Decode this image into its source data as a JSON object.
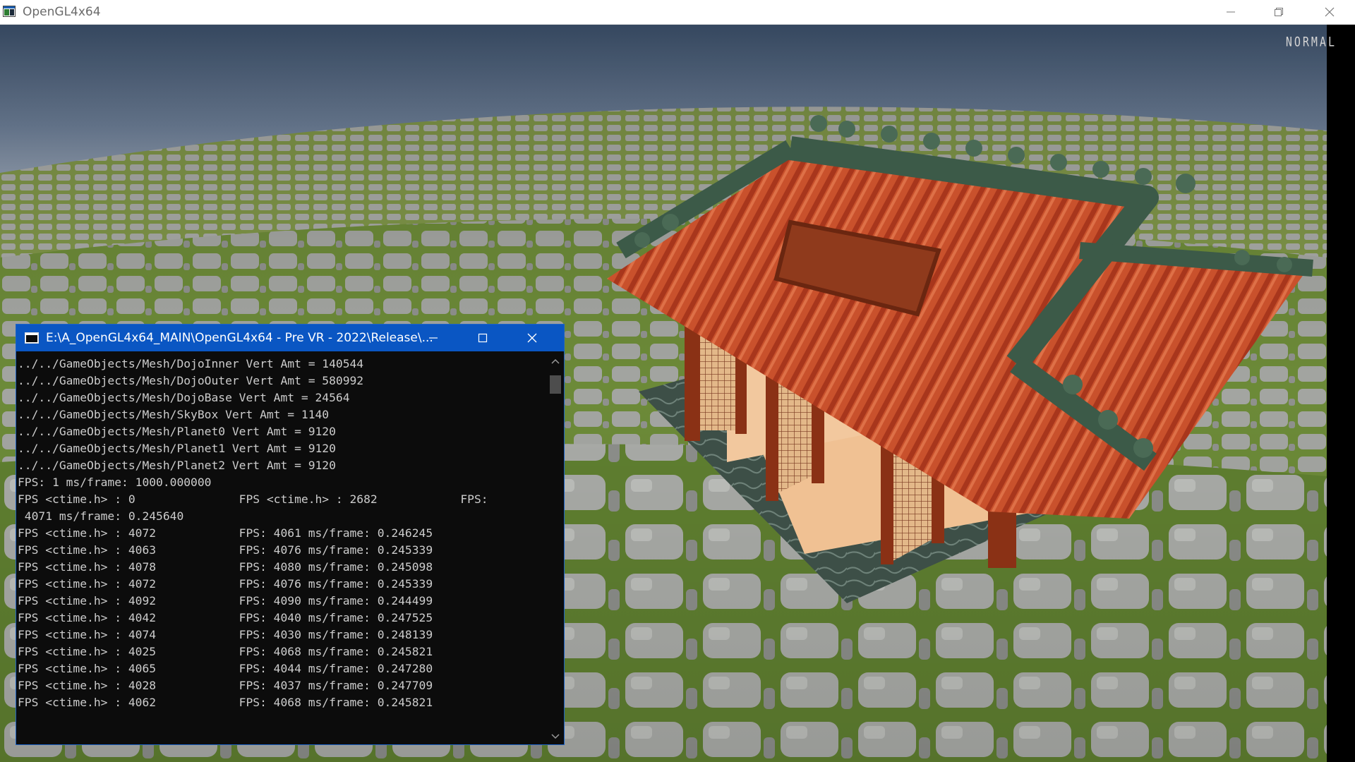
{
  "app": {
    "title": "OpenGL4x64"
  },
  "viewport": {
    "mode_label": "NORMAL"
  },
  "console": {
    "title": "E:\\A_OpenGL4x64_MAIN\\OpenGL4x64 - Pre VR - 2022\\Release\\...",
    "lines": [
      "../../GameObjects/Mesh/DojoInner Vert Amt = 140544",
      "../../GameObjects/Mesh/DojoOuter Vert Amt = 580992",
      "../../GameObjects/Mesh/DojoBase Vert Amt = 24564",
      "../../GameObjects/Mesh/SkyBox Vert Amt = 1140",
      "../../GameObjects/Mesh/Planet0 Vert Amt = 9120",
      "../../GameObjects/Mesh/Planet1 Vert Amt = 9120",
      "../../GameObjects/Mesh/Planet2 Vert Amt = 9120",
      "FPS: 1 ms/frame: 1000.000000",
      "FPS <ctime.h> : 0               FPS <ctime.h> : 2682            FPS:",
      " 4071 ms/frame: 0.245640",
      "FPS <ctime.h> : 4072            FPS: 4061 ms/frame: 0.246245",
      "FPS <ctime.h> : 4063            FPS: 4076 ms/frame: 0.245339",
      "FPS <ctime.h> : 4078            FPS: 4080 ms/frame: 0.245098",
      "FPS <ctime.h> : 4072            FPS: 4076 ms/frame: 0.245339",
      "FPS <ctime.h> : 4092            FPS: 4090 ms/frame: 0.244499",
      "FPS <ctime.h> : 4042            FPS: 4040 ms/frame: 0.247525",
      "FPS <ctime.h> : 4074            FPS: 4030 ms/frame: 0.248139",
      "FPS <ctime.h> : 4025            FPS: 4068 ms/frame: 0.245821",
      "FPS <ctime.h> : 4065            FPS: 4044 ms/frame: 0.247280",
      "FPS <ctime.h> : 4028            FPS: 4037 ms/frame: 0.247709",
      "FPS <ctime.h> : 4062            FPS: 4068 ms/frame: 0.245821"
    ]
  },
  "colors": {
    "console_titlebar": "#0a56c3",
    "console_bg": "#0c0c0c",
    "console_text": "#cccccc",
    "roof": "#b03a1e",
    "roof_trim": "#3f5a4a",
    "ground_grass": "#6e8c3c",
    "ground_stone": "#9a9c98",
    "sky": "#5b6f89"
  },
  "icons": {
    "app_icon": "console-window-icon",
    "minimize": "minimize-icon",
    "restore": "restore-icon",
    "close": "close-icon",
    "maximize": "maximize-icon"
  }
}
